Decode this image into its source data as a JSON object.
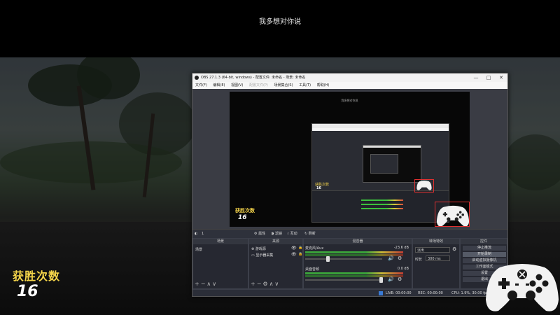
{
  "overlay": {
    "subtitle": "我多想对你说",
    "wins_title": "获胜次数",
    "wins_value": "16"
  },
  "obs": {
    "title": "OBS 27.1.3 (64-bit, windows) - 配置文件: 未命名 - 场景: 未命名",
    "window_buttons": [
      "—",
      "□",
      "✕"
    ],
    "menu": [
      {
        "label": "文件(F)",
        "enabled": true
      },
      {
        "label": "编辑(E)",
        "enabled": true
      },
      {
        "label": "视图(V)",
        "enabled": true
      },
      {
        "label": "配置文件(P)",
        "enabled": false
      },
      {
        "label": "场景集合(S)",
        "enabled": true
      },
      {
        "label": "工具(T)",
        "enabled": true
      },
      {
        "label": "帮助(H)",
        "enabled": true
      }
    ],
    "preview": {
      "caption": "我多想对你说",
      "wins_title": "获胜次数",
      "wins_value": "16"
    },
    "toolbar": {
      "scene_indicator": "1",
      "properties": "属性",
      "filters": "滤镜",
      "interact": "互动",
      "refresh": "刷新"
    },
    "docks": {
      "scenes": {
        "title": "场景",
        "items": [
          "场景"
        ]
      },
      "sources": {
        "title": "来源",
        "items": [
          "游戏源",
          "显示器采集"
        ]
      },
      "mixer": {
        "title": "混音器",
        "channels": [
          {
            "name": "麦克风/Aux",
            "db": "-23.6 dB"
          },
          {
            "name": "桌面音频",
            "db": "0.0 dB"
          }
        ]
      },
      "transition": {
        "title": "转场特效",
        "type": "淡出",
        "duration_label": "时长",
        "duration": "300 ms"
      },
      "controls": {
        "title": "控件",
        "buttons": [
          "停止推流",
          "开始录制",
          "启动虚拟摄像机",
          "工作室模式",
          "设置",
          "退出"
        ],
        "active_index": 1
      }
    },
    "status": {
      "live": "LIVE: 00:00:00",
      "rec": "REC: 00:00:00",
      "cpu": "CPU: 1.9%, 30.00 fps"
    }
  },
  "colors": {
    "wins_title": "#f6d64a",
    "obs_bg": "#2b2e38",
    "controller_white": "#f2f2f2",
    "controller_red": "#e03030"
  },
  "icons": [
    "gear-icon",
    "eye-icon",
    "lock-icon",
    "speaker-icon",
    "controller-icon",
    "plus-icon",
    "minus-icon",
    "up-icon",
    "down-icon",
    "monitor-icon"
  ]
}
